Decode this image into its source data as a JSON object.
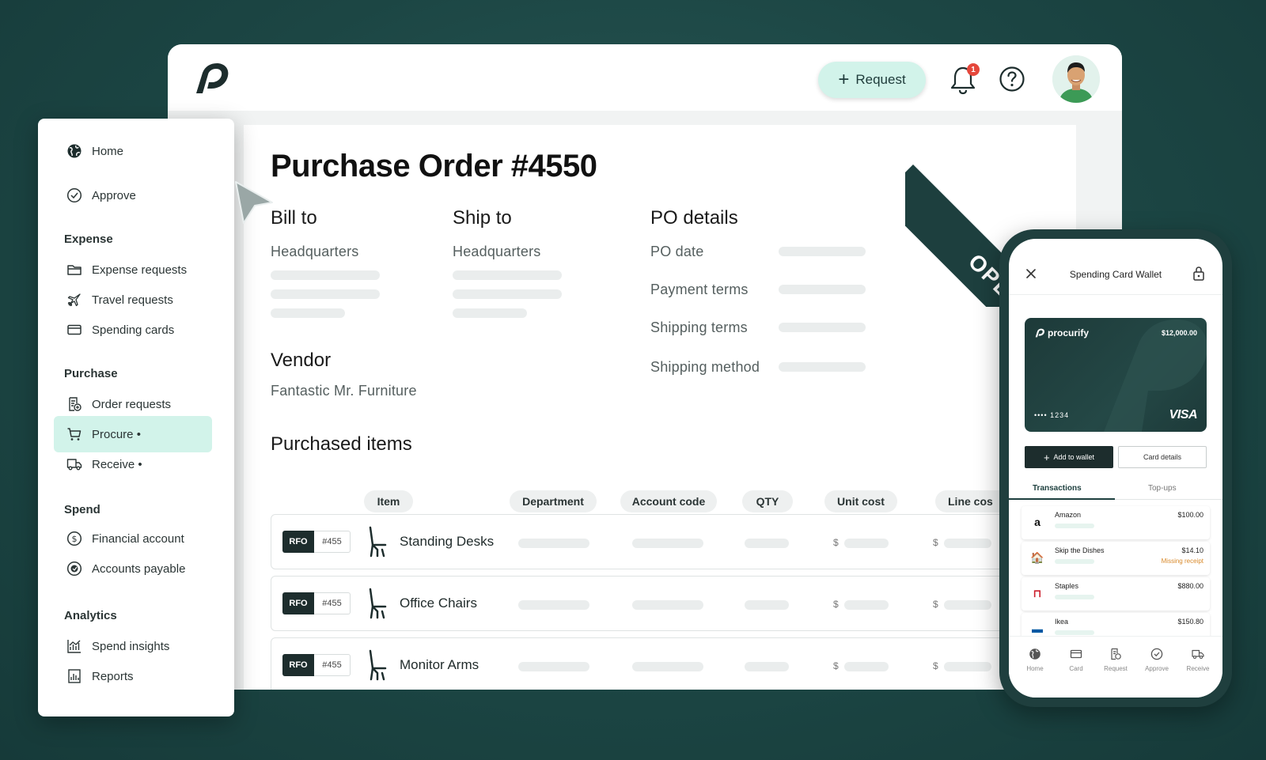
{
  "header": {
    "request_label": "Request",
    "notification_count": "1"
  },
  "po": {
    "title": "Purchase Order #4550",
    "status": "OPEN",
    "bill_to": {
      "heading": "Bill to",
      "value": "Headquarters"
    },
    "ship_to": {
      "heading": "Ship to",
      "value": "Headquarters"
    },
    "details": {
      "heading": "PO details",
      "fields": [
        "PO date",
        "Payment terms",
        "Shipping terms",
        "Shipping method"
      ]
    },
    "vendor": {
      "heading": "Vendor",
      "value": "Fantastic Mr. Furniture"
    },
    "items_heading": "Purchased items",
    "columns": [
      "Item",
      "Department",
      "Account code",
      "QTY",
      "Unit cost",
      "Line cos"
    ],
    "currency_symbol": "$",
    "rows": [
      {
        "type": "RFO",
        "number": "#455",
        "name": "Standing Desks"
      },
      {
        "type": "RFO",
        "number": "#455",
        "name": "Office Chairs"
      },
      {
        "type": "RFO",
        "number": "#455",
        "name": "Monitor Arms"
      }
    ]
  },
  "sidebar": {
    "top": [
      {
        "label": "Home",
        "icon": "globe-icon"
      },
      {
        "label": "Approve",
        "icon": "check-circle-icon"
      }
    ],
    "groups": [
      {
        "title": "Expense",
        "items": [
          {
            "label": "Expense requests",
            "icon": "folder-icon"
          },
          {
            "label": "Travel requests",
            "icon": "plane-icon"
          },
          {
            "label": "Spending cards",
            "icon": "card-icon"
          }
        ]
      },
      {
        "title": "Purchase",
        "items": [
          {
            "label": "Order requests",
            "icon": "document-icon"
          },
          {
            "label": "Procure •",
            "icon": "cart-icon",
            "active": true
          },
          {
            "label": "Receive •",
            "icon": "truck-icon"
          }
        ]
      },
      {
        "title": "Spend",
        "items": [
          {
            "label": "Financial account",
            "icon": "dollar-icon"
          },
          {
            "label": "Accounts payable",
            "icon": "payable-icon"
          }
        ]
      },
      {
        "title": "Analytics",
        "items": [
          {
            "label": "Spend insights",
            "icon": "chart-icon"
          },
          {
            "label": "Reports",
            "icon": "report-icon"
          }
        ]
      }
    ]
  },
  "phone": {
    "title": "Spending Card Wallet",
    "card": {
      "brand": "procurify",
      "amount": "$12,000.00",
      "number": "•••• 1234",
      "network": "VISA"
    },
    "add_to_wallet": "Add to wallet",
    "card_details": "Card details",
    "tabs": [
      "Transactions",
      "Top-ups"
    ],
    "transactions": [
      {
        "name": "Amazon",
        "amount": "$100.00",
        "note": "",
        "icon_text": "a",
        "color": "#111111"
      },
      {
        "name": "Skip the Dishes",
        "amount": "$14.10",
        "note": "Missing receipt",
        "icon_text": "🏠",
        "color": "#f28c1b"
      },
      {
        "name": "Staples",
        "amount": "$880.00",
        "note": "",
        "icon_text": "⊓",
        "color": "#cc1f2d"
      },
      {
        "name": "Ikea",
        "amount": "$150.80",
        "note": "",
        "icon_text": "▬",
        "color": "#0058a3"
      }
    ],
    "bottom_nav": [
      "Home",
      "Card",
      "Request",
      "Approve",
      "Receive"
    ]
  },
  "colors": {
    "background": "#1c4644",
    "accent": "#d2f3ea",
    "dark": "#1d3f3e",
    "warning": "#d98a2b"
  }
}
